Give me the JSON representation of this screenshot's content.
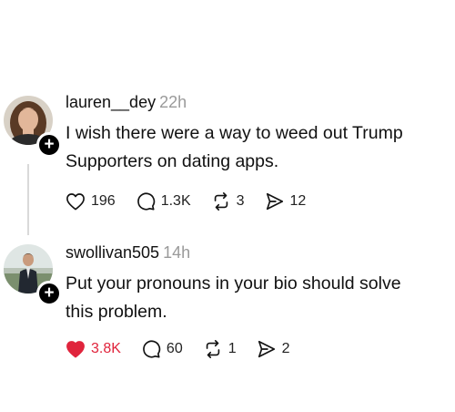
{
  "posts": [
    {
      "username": "lauren__dey",
      "timestamp": "22h",
      "text_line1": "I wish there were a way to weed out Trump",
      "text_line2": "Supporters on dating apps.",
      "likes": "196",
      "replies": "1.3K",
      "reposts": "3",
      "shares": "12",
      "liked": false
    },
    {
      "username": "swollivan505",
      "timestamp": "14h",
      "text_line1": "Put your pronouns in your bio should solve",
      "text_line2": "this problem.",
      "likes": "3.8K",
      "replies": "60",
      "reposts": "1",
      "shares": "2",
      "liked": true
    }
  ],
  "follow_badge": "+",
  "colors": {
    "like_active": "#e0243c",
    "timestamp": "#9a9a9a",
    "thread_line": "#d9d9d9"
  },
  "icons": [
    "heart-icon",
    "comment-icon",
    "repost-icon",
    "share-icon",
    "plus-icon"
  ]
}
